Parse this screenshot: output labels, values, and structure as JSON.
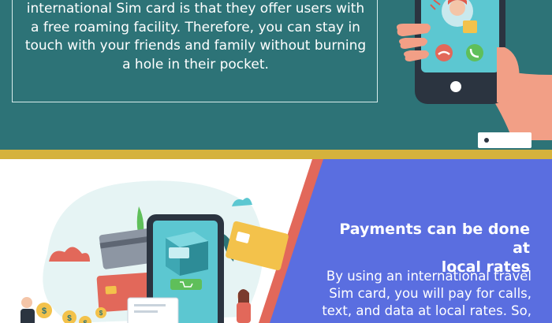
{
  "top_section": {
    "lines": [
      "international Sim card is that they offer users with",
      "a free roaming facility. Therefore, you can stay in",
      "touch with your friends and family without burning",
      "a hole in their pocket."
    ]
  },
  "bottom_section": {
    "heading_lines": [
      "Payments can be done at",
      "local rates"
    ],
    "body_lines": [
      "By using an international travel",
      "Sim card, you will pay for calls,",
      "text, and data at local rates. So,"
    ]
  },
  "colors": {
    "teal": "#2d7377",
    "gold": "#d5b23c",
    "blue_panel": "#5a6ee0",
    "coral": "#e2685a"
  },
  "icons": {
    "decline_call": "phone-down-icon",
    "accept_call": "phone-icon",
    "currency": "dollar-coin-icon",
    "cart": "cart-icon"
  }
}
